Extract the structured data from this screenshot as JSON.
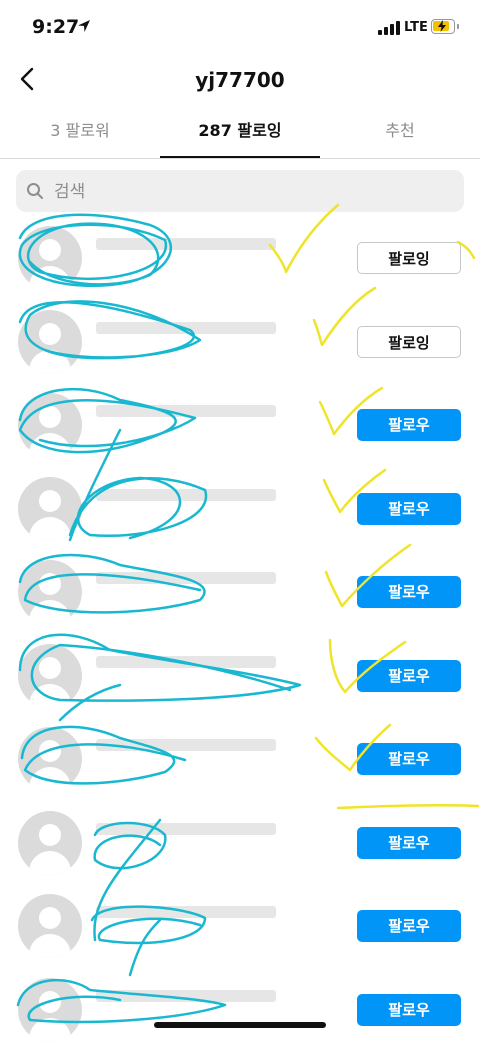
{
  "status_bar": {
    "time": "9:27",
    "network": "LTE",
    "battery_color": "#f2c200"
  },
  "nav": {
    "title": "yj77700"
  },
  "tabs": [
    {
      "label": "3 팔로워",
      "active": false
    },
    {
      "label": "287 팔로잉",
      "active": true
    },
    {
      "label": "추천",
      "active": false
    }
  ],
  "search": {
    "placeholder": "검색"
  },
  "list": [
    {
      "button": "팔로잉",
      "state": "following"
    },
    {
      "button": "팔로잉",
      "state": "following"
    },
    {
      "button": "팔로우",
      "state": "follow"
    },
    {
      "button": "팔로우",
      "state": "follow"
    },
    {
      "button": "팔로우",
      "state": "follow"
    },
    {
      "button": "팔로우",
      "state": "follow"
    },
    {
      "button": "팔로우",
      "state": "follow"
    },
    {
      "button": "팔로우",
      "state": "follow"
    },
    {
      "button": "팔로우",
      "state": "follow"
    },
    {
      "button": "팔로우",
      "state": "follow"
    }
  ],
  "colors": {
    "accent": "#0095f6",
    "scribble_cyan": "#1ab8d0",
    "check_yellow": "#f0e42a"
  }
}
